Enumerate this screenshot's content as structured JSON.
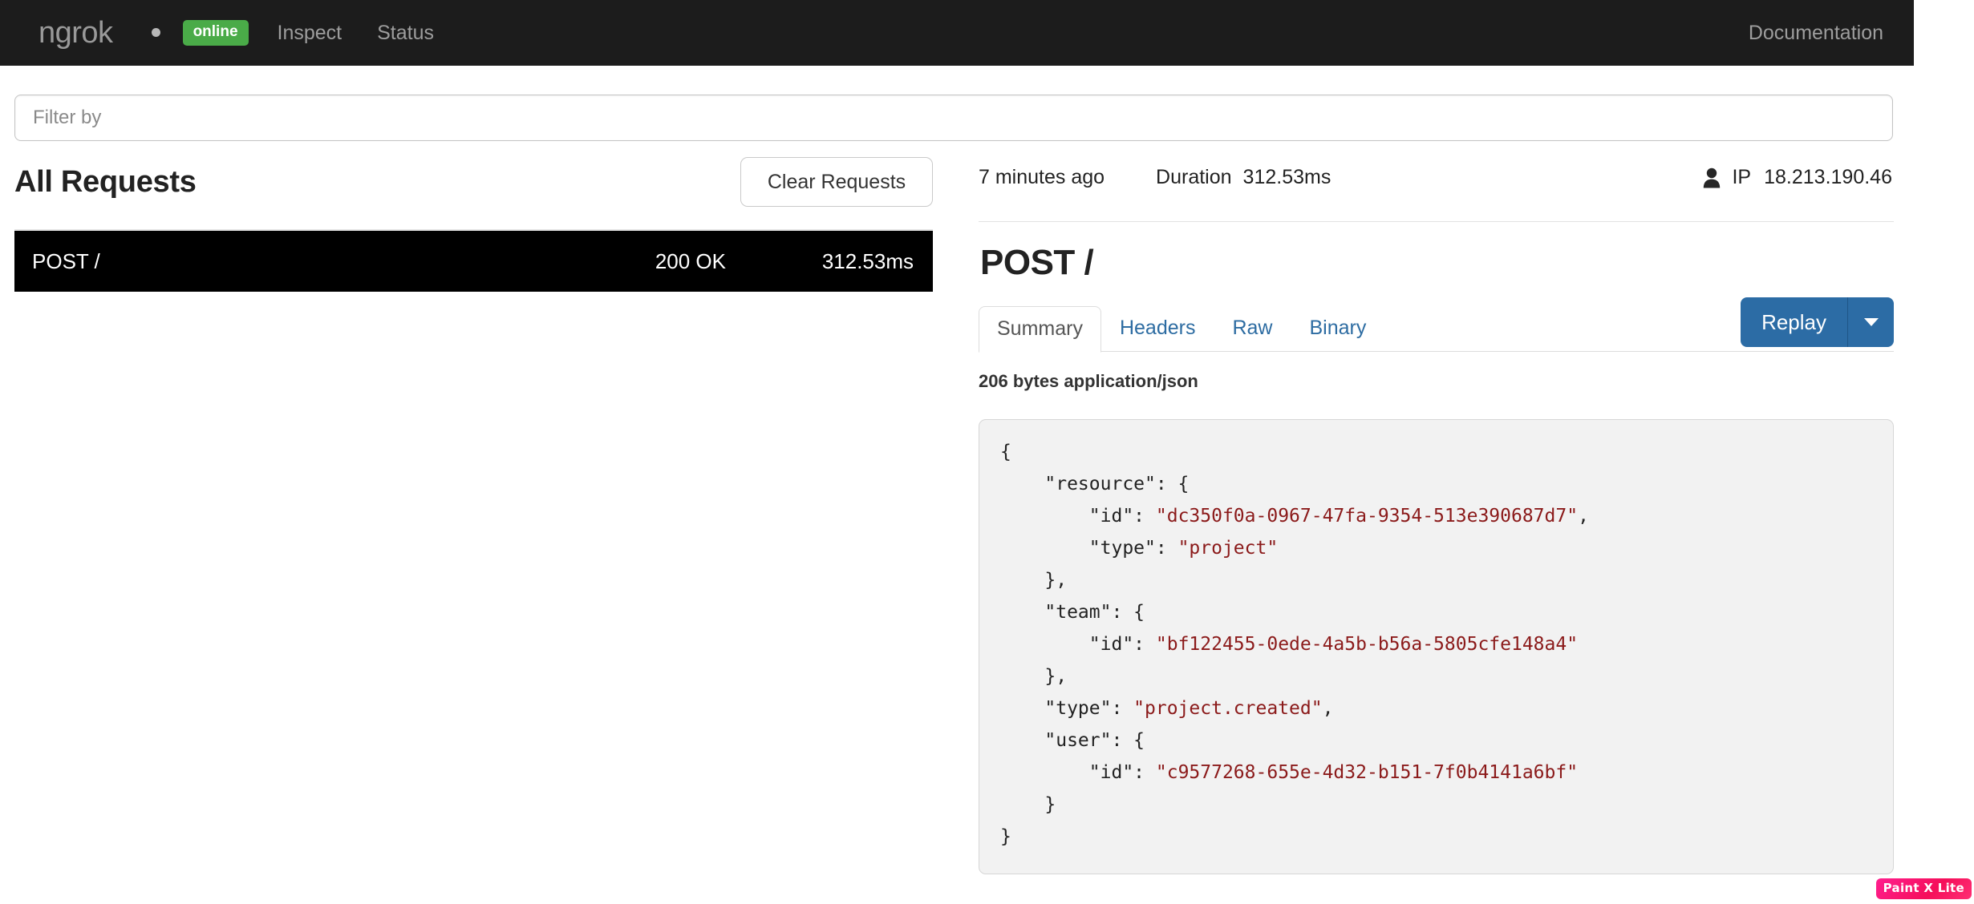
{
  "navbar": {
    "brand": "ngrok",
    "status_dot_icon": "bullet-dot-icon",
    "status_badge": "online",
    "links": [
      {
        "label": "Inspect"
      },
      {
        "label": "Status"
      }
    ],
    "right_link": "Documentation",
    "background_color": "#1c1c1c",
    "badge_color": "#4aab48",
    "link_color": "#9d9d9d"
  },
  "filter": {
    "placeholder": "Filter by",
    "value": ""
  },
  "requests_panel": {
    "title": "All Requests",
    "clear_button": "Clear Requests",
    "rows": [
      {
        "method_path": "POST /",
        "status": "200 OK",
        "duration": "312.53ms",
        "selected": true
      }
    ]
  },
  "detail": {
    "time_ago": "7 minutes ago",
    "duration_label": "Duration",
    "duration_value": "312.53ms",
    "user_icon": "user-icon",
    "ip_label": "IP",
    "ip_value": "18.213.190.46",
    "title": "POST /",
    "tabs": [
      {
        "label": "Summary",
        "active": true
      },
      {
        "label": "Headers",
        "active": false
      },
      {
        "label": "Raw",
        "active": false
      },
      {
        "label": "Binary",
        "active": false
      }
    ],
    "replay_button": "Replay",
    "replay_caret_icon": "chevron-down-icon",
    "body_meta": "206 bytes application/json",
    "accent_color": "#2c6ca5",
    "body_json": {
      "line_01": "{",
      "line_02_key": "    \"resource\": {",
      "line_03_key": "        \"id\": ",
      "line_03_val": "\"dc350f0a-0967-47fa-9354-513e390687d7\"",
      "line_03_tail": ",",
      "line_04_key": "        \"type\": ",
      "line_04_val": "\"project\"",
      "line_05": "    },",
      "line_06_key": "    \"team\": {",
      "line_07_key": "        \"id\": ",
      "line_07_val": "\"bf122455-0ede-4a5b-b56a-5805cfe148a4\"",
      "line_08": "    },",
      "line_09_key": "    \"type\": ",
      "line_09_val": "\"project.created\"",
      "line_09_tail": ",",
      "line_10_key": "    \"user\": {",
      "line_11_key": "        \"id\": ",
      "line_11_val": "\"c9577268-655e-4d32-b151-7f0b4141a6bf\"",
      "line_12": "    }",
      "line_13": "}"
    }
  },
  "watermark": {
    "label": "Paint X Lite"
  }
}
